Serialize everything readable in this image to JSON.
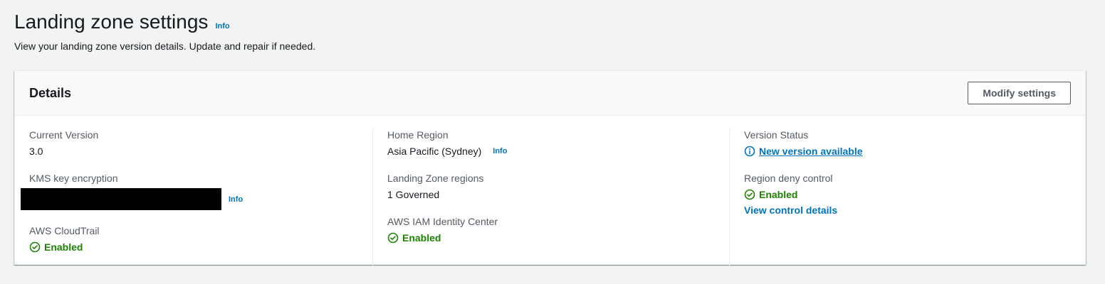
{
  "header": {
    "title": "Landing zone settings",
    "info": "Info",
    "description": "View your landing zone version details. Update and repair if needed."
  },
  "details": {
    "title": "Details",
    "modify_button": "Modify settings",
    "col1": {
      "current_version_label": "Current Version",
      "current_version_value": "3.0",
      "kms_label": "KMS key encryption",
      "kms_info": "Info",
      "cloudtrail_label": "AWS CloudTrail",
      "cloudtrail_value": "Enabled"
    },
    "col2": {
      "home_region_label": "Home Region",
      "home_region_value": "Asia Pacific (Sydney)",
      "home_region_info": "Info",
      "lz_regions_label": "Landing Zone regions",
      "lz_regions_value": "1 Governed",
      "iam_label": "AWS IAM Identity Center",
      "iam_value": "Enabled"
    },
    "col3": {
      "version_status_label": "Version Status",
      "version_status_value": "New version available",
      "region_deny_label": "Region deny control",
      "region_deny_value": "Enabled",
      "view_control_link": "View control details"
    }
  },
  "colors": {
    "success": "#1d8102",
    "link": "#0073bb",
    "background": "#f2f3f3"
  },
  "icons": {
    "success": "check-circle-icon",
    "info": "info-circle-icon"
  }
}
